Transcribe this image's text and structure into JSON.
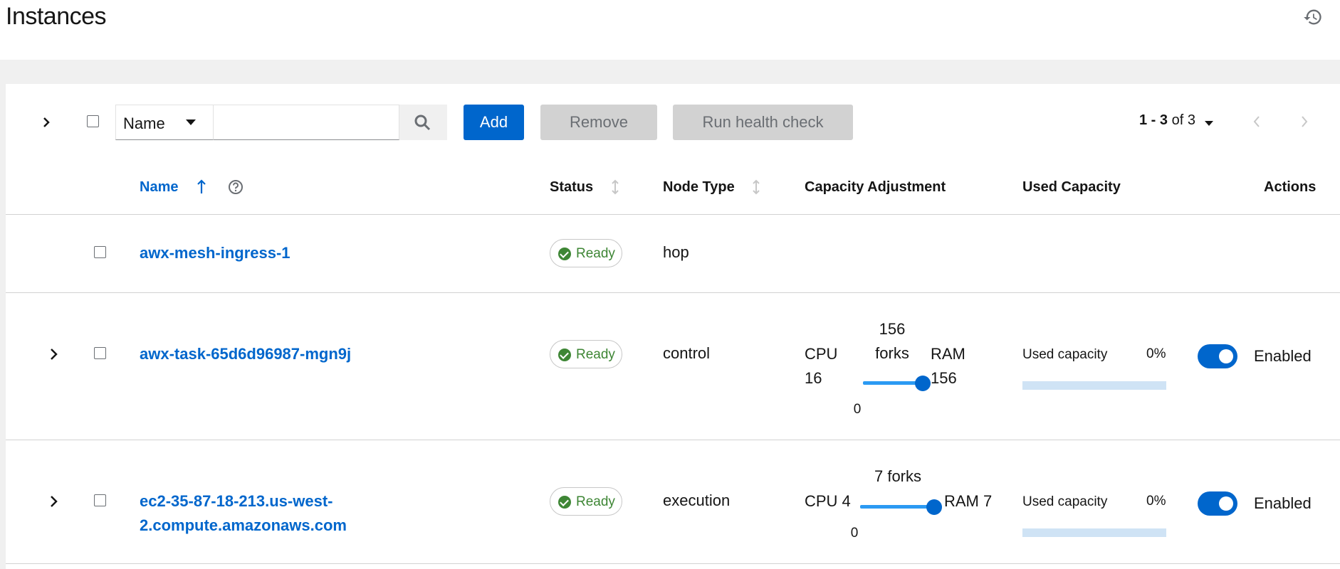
{
  "page": {
    "title": "Instances"
  },
  "toolbar": {
    "filter_select": "Name",
    "search_placeholder": "",
    "add_label": "Add",
    "remove_label": "Remove",
    "health_label": "Run health check",
    "pagination_range": "1 - 3",
    "pagination_of": "of 3"
  },
  "table": {
    "headers": {
      "name": "Name",
      "status": "Status",
      "node_type": "Node Type",
      "capacity_adjustment": "Capacity Adjustment",
      "used_capacity": "Used Capacity",
      "actions": "Actions"
    },
    "rows": [
      {
        "name": "awx-mesh-ingress-1",
        "status": "Ready",
        "node_type": "hop"
      },
      {
        "name": "awx-task-65d6d96987-mgn9j",
        "status": "Ready",
        "node_type": "control",
        "cpu_label": "CPU",
        "cpu_value": "16",
        "forks_value": "156",
        "forks_label": "forks",
        "ram_label": "RAM",
        "ram_value": "156",
        "slider_min": "0",
        "slider_level": 1.0,
        "used_label": "Used capacity",
        "used_pct": "0%",
        "used_fraction": 0,
        "enabled_label": "Enabled",
        "enabled": true
      },
      {
        "name_line1": "ec2-35-87-18-213.us-west-",
        "name_line2": "2.compute.amazonaws.com",
        "status": "Ready",
        "node_type": "execution",
        "cpu": "CPU 4",
        "forks": "7 forks",
        "ram": "RAM 7",
        "slider_min": "0",
        "slider_level": 1.0,
        "used_label": "Used capacity",
        "used_pct": "0%",
        "used_fraction": 0,
        "enabled_label": "Enabled",
        "enabled": true
      }
    ]
  },
  "colors": {
    "accent": "#0066cc",
    "success": "#3e8635",
    "disabled_bg": "#d2d2d2"
  }
}
